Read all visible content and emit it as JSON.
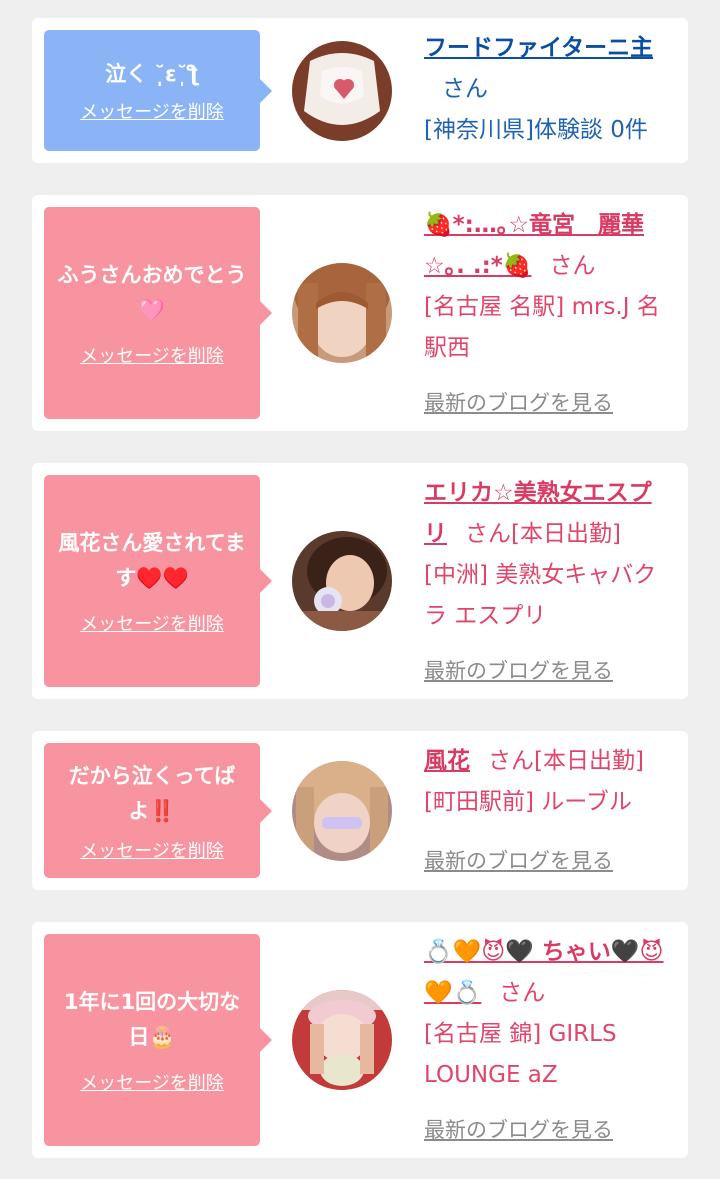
{
  "cards": [
    {
      "message": "泣く ˘̩̩̩ε˘̩ƪ",
      "delete_label": "メッセージを削除",
      "name": "フードファイターニ主",
      "san": "さん",
      "shop": "[神奈川県]体験談 0件",
      "blog": ""
    },
    {
      "message": "ふうさんおめでとう🩷",
      "delete_label": "メッセージを削除",
      "name": "🍓*:…｡☆竜宮　麗華☆｡. .:*🍓",
      "san": "さん",
      "shop": "[名古屋 名駅] mrs.J 名駅西",
      "blog": "最新のブログを見る"
    },
    {
      "message": "風花さん愛されてます♥️♥️",
      "delete_label": "メッセージを削除",
      "name": "エリカ☆美熟女エスプリ",
      "san": "さん[本日出勤]",
      "shop": "[中洲] 美熟女キャバクラ エスプリ",
      "blog": "最新のブログを見る"
    },
    {
      "message": "だから泣くってばよ‼️",
      "delete_label": "メッセージを削除",
      "name": "風花",
      "san": "さん[本日出勤]",
      "shop": "[町田駅前] ルーブル",
      "blog": "最新のブログを見る"
    },
    {
      "message": "1年に1回の大切な日🎂",
      "delete_label": "メッセージを削除",
      "name": "💍🧡😈🖤 ちゃい🖤😈🧡💍",
      "san": "さん",
      "shop": "[名古屋 錦] GIRLS LOUNGE aZ",
      "blog": "最新のブログを見る"
    }
  ],
  "colors": {
    "background": "#efefef",
    "blue_bubble": "#8ab4f5",
    "pink_bubble": "#f8949f",
    "blue_text": "#1f62b1",
    "pink_text": "#e0466b",
    "blog_link": "#8b8b8b"
  }
}
